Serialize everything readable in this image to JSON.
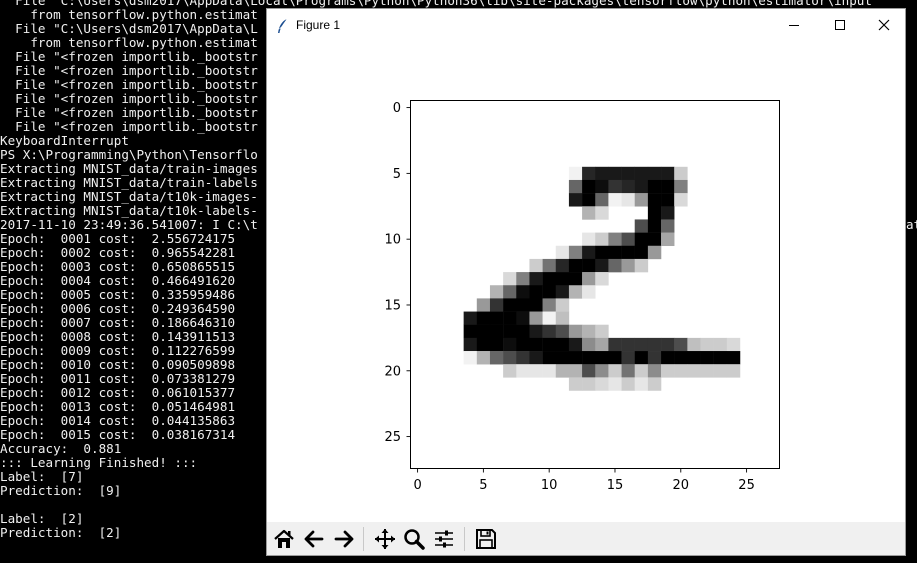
{
  "console": {
    "lines": [
      "  File \"C:\\Users\\dsm2017\\AppData\\Local\\Programs\\Python\\Python36\\lib\\site-packages\\tensorflow\\python\\estimator\\input",
      "    from tensorflow.python.estimat",
      "  File \"C:\\Users\\dsm2017\\AppData\\L",
      "    from tensorflow.python.estimat",
      "  File \"<frozen importlib._bootstr",
      "  File \"<frozen importlib._bootstr",
      "  File \"<frozen importlib._bootstr",
      "  File \"<frozen importlib._bootstr",
      "  File \"<frozen importlib._bootstr",
      "  File \"<frozen importlib._bootstr",
      "KeyboardInterrupt",
      "PS X:\\Programming\\Python\\Tensorflo",
      "Extracting MNIST_data/train-images",
      "Extracting MNIST_data/train-labels",
      "Extracting MNIST_data/t10k-images-",
      "Extracting MNIST_data/t10k-labels-",
      "2017-11-10 23:49:36.541007: I C:\\t",
      "Epoch:  0001 cost:  2.556724175",
      "Epoch:  0002 cost:  0.965542281",
      "Epoch:  0003 cost:  0.650865515",
      "Epoch:  0004 cost:  0.466491620",
      "Epoch:  0005 cost:  0.335959486",
      "Epoch:  0006 cost:  0.249364590",
      "Epoch:  0007 cost:  0.186646310",
      "Epoch:  0008 cost:  0.143911513",
      "Epoch:  0009 cost:  0.112276599",
      "Epoch:  0010 cost:  0.090509898",
      "Epoch:  0011 cost:  0.073381279",
      "Epoch:  0012 cost:  0.061015377",
      "Epoch:  0013 cost:  0.051464981",
      "Epoch:  0014 cost:  0.044135863",
      "Epoch:  0015 cost:  0.038167314",
      "Accuracy:  0.881",
      "::: Learning Finished! :::",
      "Label:  [7]",
      "Prediction:  [9]",
      "",
      "Label:  [2]",
      "Prediction:  [2]"
    ],
    "overflow_right": "at"
  },
  "figure": {
    "title": "Figure 1",
    "x_ticks": [
      "0",
      "5",
      "10",
      "15",
      "20",
      "25"
    ],
    "y_ticks": [
      "0",
      "5",
      "10",
      "15",
      "20",
      "25"
    ],
    "image_size": 28,
    "image_rows": [
      {
        "row": 5,
        "cells": [
          [
            12,
            0.05
          ],
          [
            13,
            0.85
          ],
          [
            14,
            0.9
          ],
          [
            15,
            0.9
          ],
          [
            16,
            0.9
          ],
          [
            17,
            0.9
          ],
          [
            18,
            0.9
          ],
          [
            19,
            0.9
          ],
          [
            20,
            0.2
          ]
        ]
      },
      {
        "row": 6,
        "cells": [
          [
            12,
            0.6
          ],
          [
            13,
            1
          ],
          [
            14,
            0.95
          ],
          [
            15,
            0.8
          ],
          [
            16,
            0.85
          ],
          [
            17,
            0.9
          ],
          [
            18,
            1
          ],
          [
            19,
            1
          ],
          [
            20,
            0.5
          ]
        ]
      },
      {
        "row": 7,
        "cells": [
          [
            12,
            0.9
          ],
          [
            13,
            1
          ],
          [
            14,
            0.6
          ],
          [
            15,
            0.05
          ],
          [
            16,
            0.1
          ],
          [
            17,
            0.4
          ],
          [
            18,
            1
          ],
          [
            19,
            1
          ],
          [
            20,
            0.15
          ]
        ]
      },
      {
        "row": 8,
        "cells": [
          [
            13,
            0.3
          ],
          [
            14,
            0.15
          ],
          [
            18,
            1
          ],
          [
            19,
            0.9
          ]
        ]
      },
      {
        "row": 9,
        "cells": [
          [
            17,
            0.7
          ],
          [
            18,
            1
          ],
          [
            19,
            0.6
          ]
        ]
      },
      {
        "row": 10,
        "cells": [
          [
            13,
            0.1
          ],
          [
            14,
            0.2
          ],
          [
            15,
            0.5
          ],
          [
            16,
            0.7
          ],
          [
            17,
            1
          ],
          [
            18,
            1
          ],
          [
            19,
            0.35
          ]
        ]
      },
      {
        "row": 11,
        "cells": [
          [
            11,
            0.1
          ],
          [
            12,
            0.5
          ],
          [
            13,
            0.9
          ],
          [
            14,
            1
          ],
          [
            15,
            1
          ],
          [
            16,
            1
          ],
          [
            17,
            1
          ],
          [
            18,
            0.4
          ]
        ]
      },
      {
        "row": 12,
        "cells": [
          [
            9,
            0.2
          ],
          [
            10,
            0.55
          ],
          [
            11,
            0.85
          ],
          [
            12,
            1
          ],
          [
            13,
            1
          ],
          [
            14,
            0.9
          ],
          [
            15,
            0.6
          ],
          [
            16,
            0.4
          ],
          [
            17,
            0.2
          ]
        ]
      },
      {
        "row": 13,
        "cells": [
          [
            7,
            0.15
          ],
          [
            8,
            0.5
          ],
          [
            9,
            0.9
          ],
          [
            10,
            1
          ],
          [
            11,
            1
          ],
          [
            12,
            1
          ],
          [
            13,
            0.4
          ],
          [
            14,
            0.15
          ]
        ]
      },
      {
        "row": 14,
        "cells": [
          [
            6,
            0.3
          ],
          [
            7,
            0.6
          ],
          [
            8,
            0.95
          ],
          [
            9,
            1
          ],
          [
            10,
            1
          ],
          [
            11,
            0.9
          ],
          [
            12,
            0.3
          ],
          [
            13,
            0.1
          ]
        ]
      },
      {
        "row": 15,
        "cells": [
          [
            5,
            0.4
          ],
          [
            6,
            0.8
          ],
          [
            7,
            1
          ],
          [
            8,
            1
          ],
          [
            9,
            1
          ],
          [
            10,
            0.5
          ],
          [
            11,
            0.2
          ]
        ]
      },
      {
        "row": 16,
        "cells": [
          [
            4,
            0.9
          ],
          [
            5,
            1
          ],
          [
            6,
            1
          ],
          [
            7,
            1
          ],
          [
            8,
            0.95
          ],
          [
            9,
            0.4
          ],
          [
            10,
            0.05
          ],
          [
            11,
            0.25
          ]
        ]
      },
      {
        "row": 17,
        "cells": [
          [
            4,
            1
          ],
          [
            5,
            1
          ],
          [
            6,
            1
          ],
          [
            7,
            1
          ],
          [
            8,
            1
          ],
          [
            9,
            0.9
          ],
          [
            10,
            0.8
          ],
          [
            11,
            0.7
          ],
          [
            12,
            0.4
          ],
          [
            13,
            0.3
          ],
          [
            14,
            0.2
          ]
        ]
      },
      {
        "row": 18,
        "cells": [
          [
            4,
            0.9
          ],
          [
            5,
            1
          ],
          [
            6,
            1
          ],
          [
            7,
            0.95
          ],
          [
            8,
            1
          ],
          [
            9,
            1
          ],
          [
            10,
            1
          ],
          [
            11,
            1
          ],
          [
            12,
            0.9
          ],
          [
            13,
            0.45
          ],
          [
            14,
            0.35
          ],
          [
            15,
            0.8
          ],
          [
            16,
            0.8
          ],
          [
            17,
            0.8
          ],
          [
            18,
            0.8
          ],
          [
            19,
            0.8
          ],
          [
            20,
            0.7
          ],
          [
            21,
            0.25
          ],
          [
            22,
            0.2
          ],
          [
            23,
            0.2
          ],
          [
            24,
            0.15
          ]
        ]
      },
      {
        "row": 19,
        "cells": [
          [
            4,
            0.05
          ],
          [
            5,
            0.3
          ],
          [
            6,
            0.6
          ],
          [
            7,
            0.7
          ],
          [
            8,
            0.8
          ],
          [
            9,
            0.9
          ],
          [
            10,
            1
          ],
          [
            11,
            1
          ],
          [
            12,
            1
          ],
          [
            13,
            1
          ],
          [
            14,
            1
          ],
          [
            15,
            1
          ],
          [
            16,
            0.8
          ],
          [
            17,
            1
          ],
          [
            18,
            0.8
          ],
          [
            19,
            1
          ],
          [
            20,
            1
          ],
          [
            21,
            1
          ],
          [
            22,
            1
          ],
          [
            23,
            1
          ],
          [
            24,
            1
          ]
        ]
      },
      {
        "row": 20,
        "cells": [
          [
            7,
            0.2
          ],
          [
            8,
            0.1
          ],
          [
            9,
            0.1
          ],
          [
            10,
            0.1
          ],
          [
            11,
            0.3
          ],
          [
            12,
            0.3
          ],
          [
            13,
            0.7
          ],
          [
            14,
            0.45
          ],
          [
            15,
            0.2
          ],
          [
            16,
            0.55
          ],
          [
            17,
            0.2
          ],
          [
            18,
            0.45
          ],
          [
            19,
            0.2
          ],
          [
            20,
            0.2
          ],
          [
            21,
            0.2
          ],
          [
            22,
            0.2
          ],
          [
            23,
            0.2
          ],
          [
            24,
            0.2
          ]
        ]
      },
      {
        "row": 21,
        "cells": [
          [
            12,
            0.2
          ],
          [
            13,
            0.2
          ],
          [
            14,
            0.15
          ],
          [
            15,
            0.1
          ],
          [
            16,
            0.2
          ],
          [
            17,
            0.1
          ],
          [
            18,
            0.2
          ]
        ]
      }
    ]
  },
  "toolbar": {
    "buttons": [
      {
        "name": "home-icon",
        "label": "Home"
      },
      {
        "name": "back-arrow-icon",
        "label": "Back"
      },
      {
        "name": "forward-arrow-icon",
        "label": "Forward"
      },
      {
        "name": "pan-icon",
        "label": "Pan"
      },
      {
        "name": "zoom-icon",
        "label": "Zoom"
      },
      {
        "name": "subplots-icon",
        "label": "Configure subplots"
      },
      {
        "name": "save-icon",
        "label": "Save"
      }
    ]
  },
  "colors": {
    "console_bg": "#000000",
    "console_text": "#f0f0f0",
    "toolbar_bg": "#f0f0f0",
    "window_border": "#9b9b9b"
  }
}
